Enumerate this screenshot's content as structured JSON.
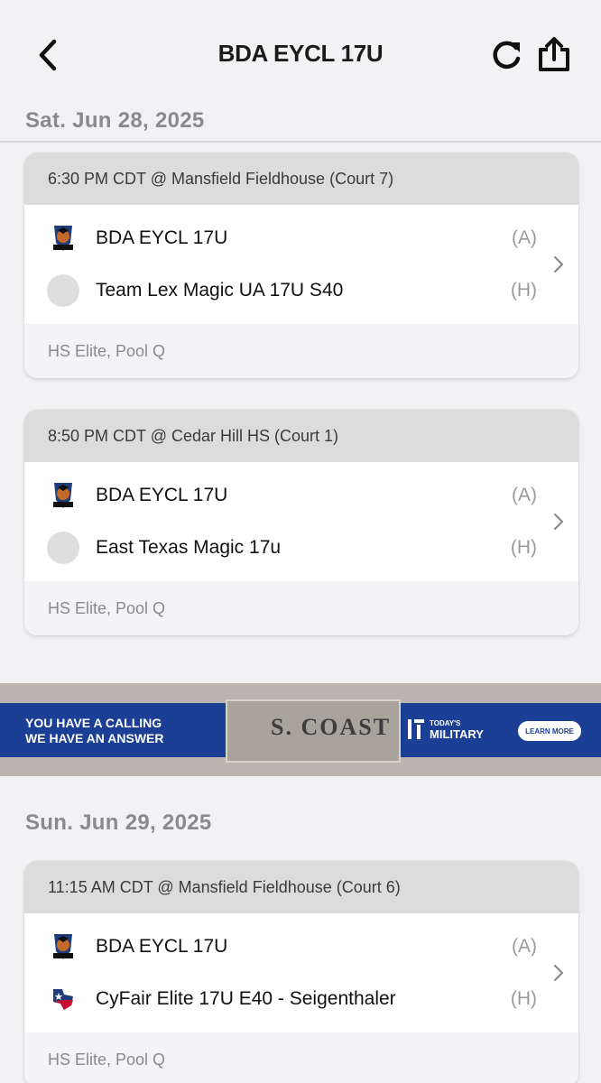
{
  "header": {
    "title": "BDA EYCL 17U"
  },
  "days": [
    {
      "date": "Sat. Jun 28, 2025",
      "games": [
        {
          "time_location": "6:30 PM CDT @ Mansfield Fieldhouse (Court 7)",
          "away": {
            "name": "BDA EYCL 17U",
            "side": "(A)"
          },
          "home": {
            "name": "Team Lex Magic UA 17U S40",
            "side": "(H)"
          },
          "division": "HS Elite, Pool Q"
        },
        {
          "time_location": "8:50 PM CDT @ Cedar Hill HS (Court 1)",
          "away": {
            "name": "BDA EYCL 17U",
            "side": "(A)"
          },
          "home": {
            "name": "East Texas Magic 17u",
            "side": "(H)"
          },
          "division": "HS Elite, Pool Q"
        }
      ]
    },
    {
      "date": "Sun. Jun 29, 2025",
      "games": [
        {
          "time_location": "11:15 AM CDT @ Mansfield Fieldhouse (Court 6)",
          "away": {
            "name": "BDA EYCL 17U",
            "side": "(A)"
          },
          "home": {
            "name": "CyFair Elite 17U E40 - Seigenthaler",
            "side": "(H)"
          },
          "division": "HS Elite, Pool Q"
        }
      ]
    }
  ],
  "ad": {
    "headline_line1": "YOU HAVE A CALLING",
    "headline_line2": "WE HAVE AN ANSWER",
    "photo_text": "S. COAST",
    "brand_line1": "TODAY'S",
    "brand_line2": "MILITARY",
    "cta": "LEARN MORE"
  },
  "colors": {
    "background": "#f2f2f4",
    "card_header": "#dcdcdc",
    "ad_blue": "#1c3f96",
    "muted_text": "#8a8a8e"
  },
  "icons": {
    "back": "chevron-left-icon",
    "refresh": "refresh-icon",
    "share": "share-icon",
    "disclosure": "chevron-right-icon",
    "team_logo_ravens": "ravens-logo-icon",
    "team_logo_cyfair": "texas-flag-logo-icon"
  }
}
